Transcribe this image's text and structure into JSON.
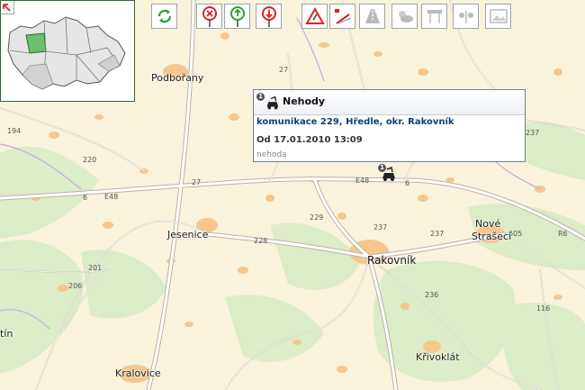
{
  "toolbar": {
    "buttons": [
      {
        "name": "refresh-button",
        "icon": "refresh-icon"
      },
      {
        "name": "closure-layer-button",
        "icon": "closure-marker-icon"
      },
      {
        "name": "info-layer-button",
        "icon": "info-marker-icon"
      },
      {
        "name": "restriction-layer-button",
        "icon": "restriction-marker-icon"
      },
      {
        "name": "warning-layer-button",
        "icon": "warning-sign-icon"
      },
      {
        "name": "roadwork-layer-button",
        "icon": "roadwork-icon"
      },
      {
        "name": "road-condition-layer-button",
        "icon": "road-condition-icon"
      },
      {
        "name": "weather-layer-button",
        "icon": "weather-icon"
      },
      {
        "name": "traffic-sign-layer-button",
        "icon": "traffic-sign-icon"
      },
      {
        "name": "wind-layer-button",
        "icon": "wind-icon"
      },
      {
        "name": "camera-layer-button",
        "icon": "camera-image-icon"
      }
    ]
  },
  "popup": {
    "badge": "1",
    "title": "Nehody",
    "road": "komunikace 229, Hředle, okr. Rakovník",
    "date": "Od 17.01.2010 13:09",
    "type": "nehoda"
  },
  "marker": {
    "badge": "1",
    "icon": "accident-marker-icon"
  },
  "towns": {
    "podborany": "Podbořany",
    "jesenice": "Jesenice",
    "rakovnik": "Rakovník",
    "nove_straseci_1": "Nové",
    "nove_straseci_2": "Strašecí",
    "krivoklat": "Křivoklát",
    "kralovice": "Kralovice",
    "tin": "tín"
  },
  "roads": {
    "e48_west": "E48",
    "e48_east": "E48",
    "r6": "R6",
    "n6_west": "6",
    "n6_east": "6",
    "n27": "27",
    "n27b": "27",
    "n228": "228",
    "n229": "229",
    "n237a": "237",
    "n237b": "237",
    "n237c": "237",
    "n206": "206",
    "n220": "220",
    "n194": "194",
    "n605": "605",
    "n116": "116",
    "n236": "236",
    "n201": "201"
  },
  "colors": {
    "land": "#f9f3dc",
    "forest": "#d9ecc4",
    "settlement": "#f5c78f",
    "road": "#ffffff",
    "region_selected": "#6cbf6c"
  }
}
